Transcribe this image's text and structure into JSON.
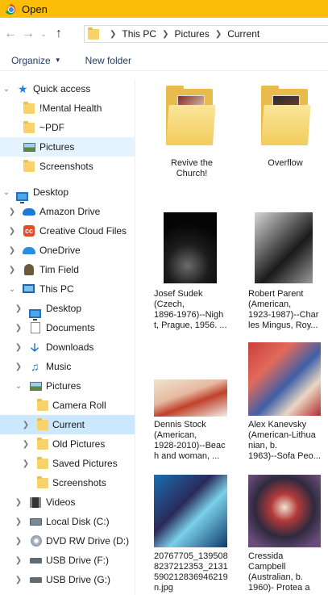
{
  "window": {
    "title": "Open"
  },
  "address": {
    "crumbs": [
      "This PC",
      "Pictures",
      "Current"
    ]
  },
  "toolbar": {
    "organize": "Organize",
    "new_folder": "New folder"
  },
  "nav": {
    "quick_access": "Quick access",
    "qa_items": [
      "!Mental Health",
      "~PDF",
      "Pictures",
      "Screenshots"
    ],
    "desktop_root": "Desktop",
    "desktop_items": [
      "Amazon Drive",
      "Creative Cloud Files",
      "OneDrive",
      "Tim Field",
      "This PC"
    ],
    "thispc_items": [
      "Desktop",
      "Documents",
      "Downloads",
      "Music",
      "Pictures"
    ],
    "pictures_items": [
      "Camera Roll",
      "Current",
      "Old Pictures",
      "Saved Pictures",
      "Screenshots"
    ],
    "after_items": [
      "Videos",
      "Local Disk (C:)",
      "DVD RW Drive (D:)",
      "USB Drive (F:)",
      "USB Drive (G:)"
    ]
  },
  "files": [
    {
      "caption": "Revive the\nChurch!",
      "kind": "folder"
    },
    {
      "caption": "Overflow",
      "kind": "folder"
    },
    {
      "caption": "Josef Sudek\n(Czech,\n1896-1976)--Nigh\nt, Prague, 1956. ...",
      "kind": "image"
    },
    {
      "caption": "Robert Parent\n(American,\n1923-1987)--Char\nles Mingus, Roy...",
      "kind": "image"
    },
    {
      "caption": "Dennis Stock\n(American,\n1928-2010)--Beac\nh and woman, ...",
      "kind": "image"
    },
    {
      "caption": "Alex Kanevsky\n(American-Lithua\nnian, b.\n1963)--Sofa Peo...",
      "kind": "image"
    },
    {
      "caption": "20767705_139508\n8237212353_2131\n590212836946219\nn.jpg",
      "kind": "image"
    },
    {
      "caption": "Cressida\nCampbell\n(Australian, b.\n1960)- Protea a",
      "kind": "image"
    }
  ],
  "colors": {
    "titlebar": "#fbbd08",
    "selection": "#cce8ff",
    "hover": "#e5f3ff"
  }
}
